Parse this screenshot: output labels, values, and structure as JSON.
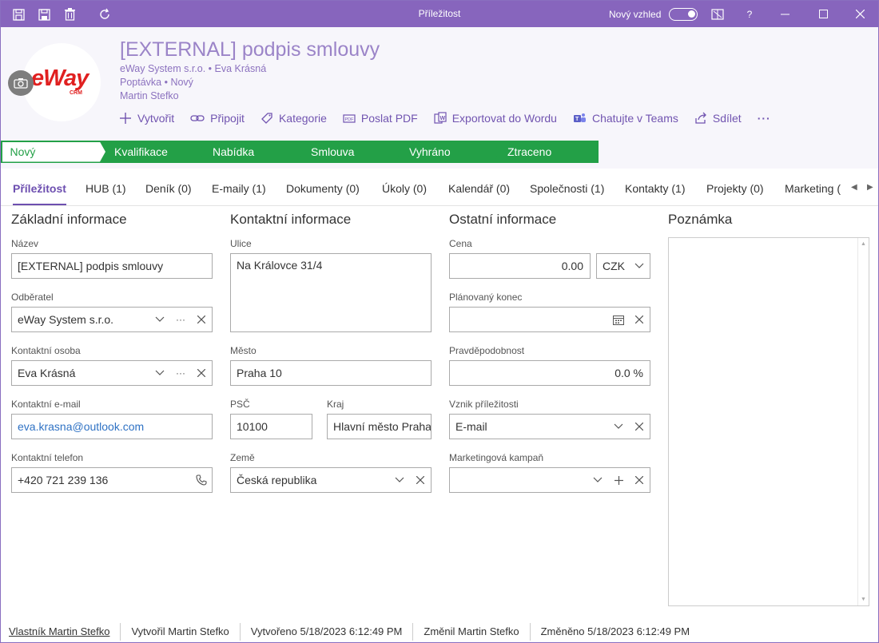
{
  "window": {
    "title": "Příležitost",
    "new_look_label": "Nový vzhled",
    "help": "?"
  },
  "header": {
    "logo_text": "eWay",
    "logo_sub": "CRM",
    "title": "[EXTERNAL] podpis smlouvy",
    "line1": "eWay System s.r.o. • Eva Krásná",
    "line2": "Poptávka • Nový",
    "line3": "Martin Stefko"
  },
  "actions": [
    {
      "label": "Vytvořit",
      "icon": "plus-icon"
    },
    {
      "label": "Připojit",
      "icon": "link-icon"
    },
    {
      "label": "Kategorie",
      "icon": "tag-icon"
    },
    {
      "label": "Poslat PDF",
      "icon": "pdf-icon"
    },
    {
      "label": "Exportovat do Wordu",
      "icon": "word-icon"
    },
    {
      "label": "Chatujte v Teams",
      "icon": "teams-icon"
    },
    {
      "label": "Sdílet",
      "icon": "share-icon"
    },
    {
      "label": "···",
      "icon": "more-icon"
    }
  ],
  "stages": [
    "Nový",
    "Kvalifikace",
    "Nabídka",
    "Smlouva",
    "Vyhráno",
    "Ztraceno"
  ],
  "tabs": [
    "Příležitost",
    "HUB (1)",
    "Deník (0)",
    "E-maily (1)",
    "Dokumenty (0)",
    "Úkoly (0)",
    "Kalendář (0)",
    "Společnosti (1)",
    "Kontakty (1)",
    "Projekty (0)",
    "Marketing ("
  ],
  "sections": {
    "basic": "Základní informace",
    "contact": "Kontaktní informace",
    "other": "Ostatní informace",
    "note": "Poznámka"
  },
  "fields": {
    "name_label": "Název",
    "name_value": "[EXTERNAL] podpis smlouvy",
    "customer_label": "Odběratel",
    "customer_value": "eWay System s.r.o.",
    "contact_label": "Kontaktní osoba",
    "contact_value": "Eva Krásná",
    "email_label": "Kontaktní e-mail",
    "email_value": "eva.krasna@outlook.com",
    "phone_label": "Kontaktní telefon",
    "phone_value": "+420 721 239 136",
    "street_label": "Ulice",
    "street_value": "Na Královce 31/4",
    "city_label": "Město",
    "city_value": "Praha 10",
    "zip_label": "PSČ",
    "zip_value": "10100",
    "region_label": "Kraj",
    "region_value": "Hlavní město Praha",
    "country_label": "Země",
    "country_value": "Česká republika",
    "price_label": "Cena",
    "price_value": "0.00",
    "currency_value": "CZK",
    "end_label": "Plánovaný konec",
    "end_value": "",
    "prob_label": "Pravděpodobnost",
    "prob_value": "0.0 %",
    "origin_label": "Vznik příležitosti",
    "origin_value": "E-mail",
    "campaign_label": "Marketingová kampaň",
    "campaign_value": ""
  },
  "footer": [
    "Vlastník Martin Stefko",
    "Vytvořil Martin Stefko",
    "Vytvořeno 5/18/2023 6:12:49 PM",
    "Změnil Martin Stefko",
    "Změněno 5/18/2023 6:12:49 PM"
  ],
  "colors": {
    "titlebar": "#8765bd",
    "accent": "#6d4fb0",
    "stage": "#23a047",
    "link": "#2f72c4"
  }
}
